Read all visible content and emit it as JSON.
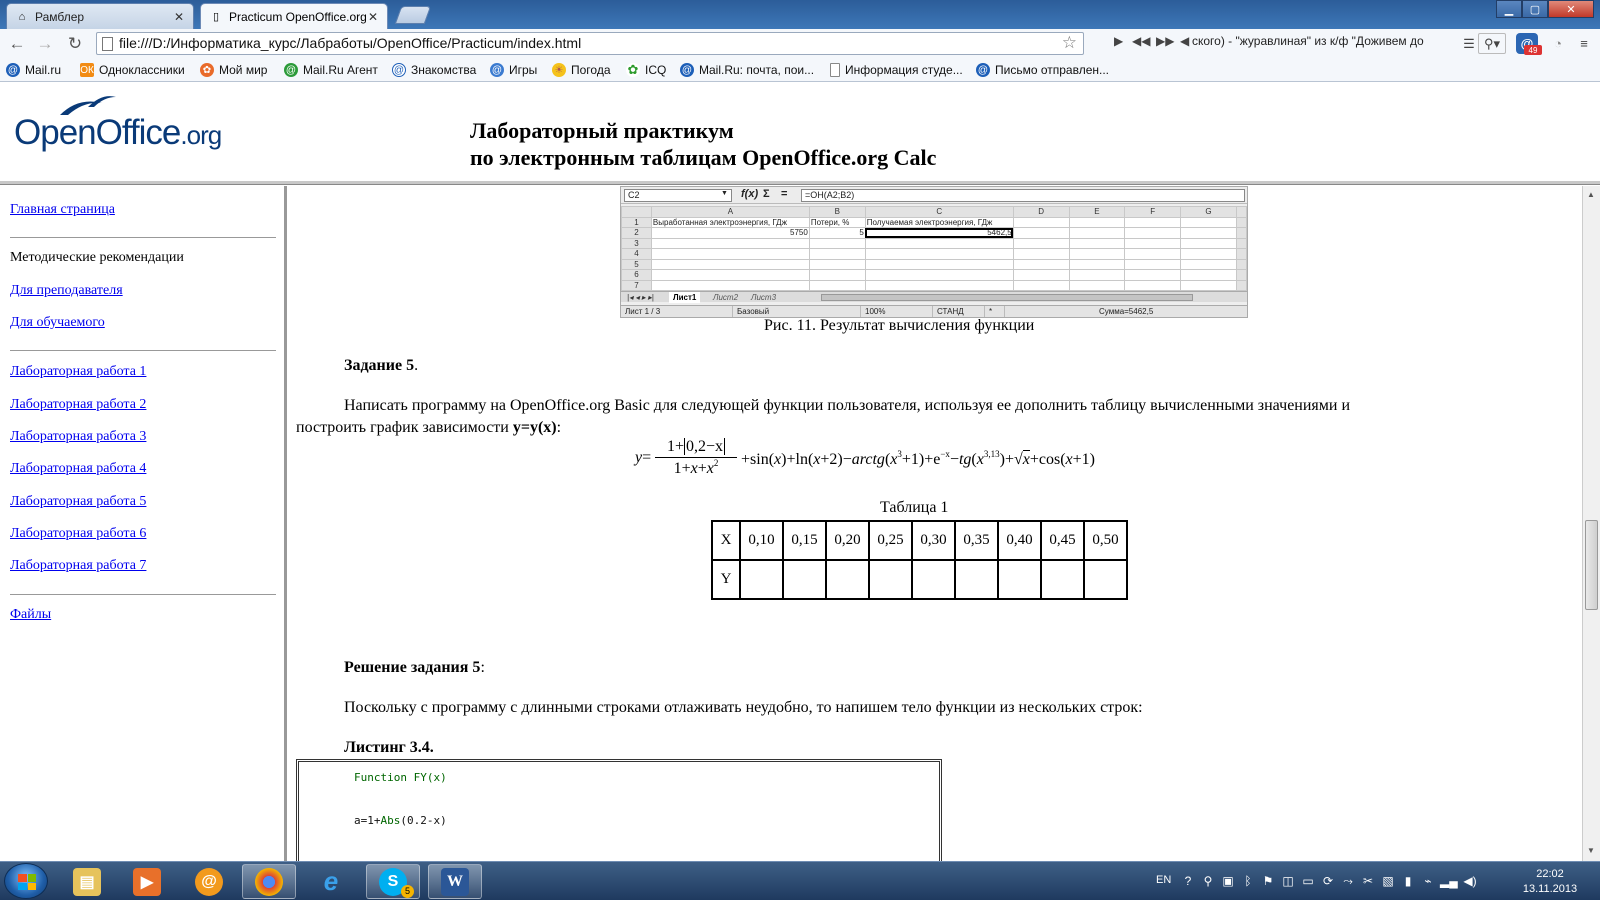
{
  "browser": {
    "tabs": [
      {
        "label": "Рамблер",
        "active": false
      },
      {
        "label": "Practicum OpenOffice.org",
        "active": true
      }
    ],
    "address": "file:///D:/Информатика_курс/Лабработы/OpenOffice/Practicum/index.html",
    "now_playing": "ского) - \"журавлиная\" из к/ф \"Доживем до",
    "extension_badge": "49",
    "bookmarks": [
      "Mail.ru",
      "Одноклассники",
      "Мой мир",
      "Mail.Ru Агент",
      "Знакомства",
      "Игры",
      "Погода",
      "ICQ",
      "Mail.Ru: почта, пои...",
      "Информация студе...",
      "Письмо отправлен..."
    ]
  },
  "header": {
    "logo_main": "OpenOffice",
    "logo_suffix": ".org",
    "title_line1": "Лабораторный практикум",
    "title_line2": "по электронным таблицам OpenOffice.org Calc"
  },
  "sidebar": {
    "home": "Главная страница",
    "section_methods": "Методические рекомендации",
    "for_teacher": "Для преподавателя",
    "for_student": "Для обучаемого",
    "labs": [
      "Лабораторная работа 1",
      "Лабораторная работа 2",
      "Лабораторная работа 3",
      "Лабораторная работа 4",
      "Лабораторная работа 5",
      "Лабораторная работа 6",
      "Лабораторная работа 7"
    ],
    "files": "Файлы"
  },
  "calc_figure": {
    "cell_ref": "C2",
    "formula": "=ОН(A2;B2)",
    "columns": [
      "A",
      "B",
      "C",
      "D",
      "E",
      "F",
      "G"
    ],
    "rows": [
      "1",
      "2",
      "3",
      "4",
      "5",
      "6",
      "7"
    ],
    "a1": "Выработанная электроэнергия, ГДж",
    "b1": "Потери, %",
    "c1": "Получаемая электроэнергия, ГДж",
    "a2": "5750",
    "b2": "5",
    "c2": "5462,5",
    "sheets": [
      "Лист1",
      "Лист2",
      "Лист3"
    ],
    "status_sheet": "Лист 1 / 3",
    "status_style": "Базовый",
    "status_zoom": "100%",
    "status_mode": "СТАНД",
    "status_sum": "Сумма=5462,5"
  },
  "content": {
    "figure_caption": "Рис. 11. Результат вычисления функции",
    "task_label": "Задание 5",
    "task_text": "Написать программу на OpenOffice.org Basic для следующей функции пользователя, используя ее дополнить таблицу вычисленными значениями и",
    "task_text2": "построить график зависимости",
    "task_dep": "y=y(x)",
    "table_caption": "Таблица 1",
    "table_x_label": "X",
    "table_y_label": "Y",
    "table_x_values": [
      "0,10",
      "0,15",
      "0,20",
      "0,25",
      "0,30",
      "0,35",
      "0,40",
      "0,45",
      "0,50"
    ],
    "solution_label": "Решение задания 5",
    "solution_text": "Поскольку с программу с длинными строками отлаживать неудобно, то напишем тело функции из нескольких строк:",
    "listing_label": "Листинг 3.4.",
    "code_line1_kw": "Function",
    "code_line1_rest": "FY(x)",
    "code_line2_var": "a=1+",
    "code_line2_fn": "Abs",
    "code_line2_rest": "(0.2-x)"
  },
  "taskbar": {
    "lang": "EN",
    "time": "22:02",
    "date": "13.11.2013",
    "skype_badge": "5"
  }
}
